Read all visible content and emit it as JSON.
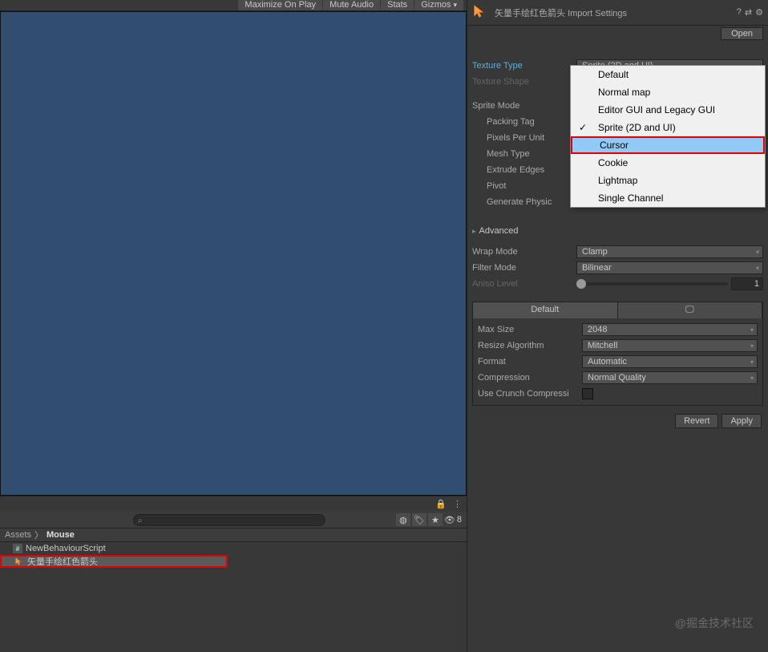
{
  "toolbar": {
    "maximize": "Maximize On Play",
    "mute": "Mute Audio",
    "stats": "Stats",
    "gizmos": "Gizmos"
  },
  "breadcrumb": {
    "root": "Assets",
    "sep": "〉",
    "current": "Mouse"
  },
  "assets": {
    "items": [
      {
        "name": "NewBehaviourScript",
        "icon": "csharp"
      },
      {
        "name": "矢量手绘红色箭头",
        "icon": "arrow"
      }
    ],
    "hidden_count": "8"
  },
  "inspector": {
    "asset_name": "矢量手绘红色箭头",
    "title_suffix": "Import Settings",
    "open": "Open",
    "texture_type": {
      "label": "Texture Type",
      "value": "Sprite (2D and UI)"
    },
    "texture_shape": {
      "label": "Texture Shape"
    },
    "sprite_mode": {
      "label": "Sprite Mode"
    },
    "packing_tag": {
      "label": "Packing Tag"
    },
    "pixels_per_unit": {
      "label": "Pixels Per Unit"
    },
    "mesh_type": {
      "label": "Mesh Type"
    },
    "extrude_edges": {
      "label": "Extrude Edges"
    },
    "pivot": {
      "label": "Pivot"
    },
    "generate_physics": {
      "label": "Generate Physic"
    },
    "advanced": "Advanced",
    "wrap_mode": {
      "label": "Wrap Mode",
      "value": "Clamp"
    },
    "filter_mode": {
      "label": "Filter Mode",
      "value": "Bilinear"
    },
    "aniso_level": {
      "label": "Aniso Level",
      "value": "1"
    },
    "default_tab": "Default",
    "max_size": {
      "label": "Max Size",
      "value": "2048"
    },
    "resize_algo": {
      "label": "Resize Algorithm",
      "value": "Mitchell"
    },
    "format": {
      "label": "Format",
      "value": "Automatic"
    },
    "compression": {
      "label": "Compression",
      "value": "Normal Quality"
    },
    "crunch": {
      "label": "Use Crunch Compressi"
    },
    "revert": "Revert",
    "apply": "Apply"
  },
  "dropdown": {
    "items": [
      "Default",
      "Normal map",
      "Editor GUI and Legacy GUI",
      "Sprite (2D and UI)",
      "Cursor",
      "Cookie",
      "Lightmap",
      "Single Channel"
    ]
  },
  "watermark": "@掘金技术社区"
}
